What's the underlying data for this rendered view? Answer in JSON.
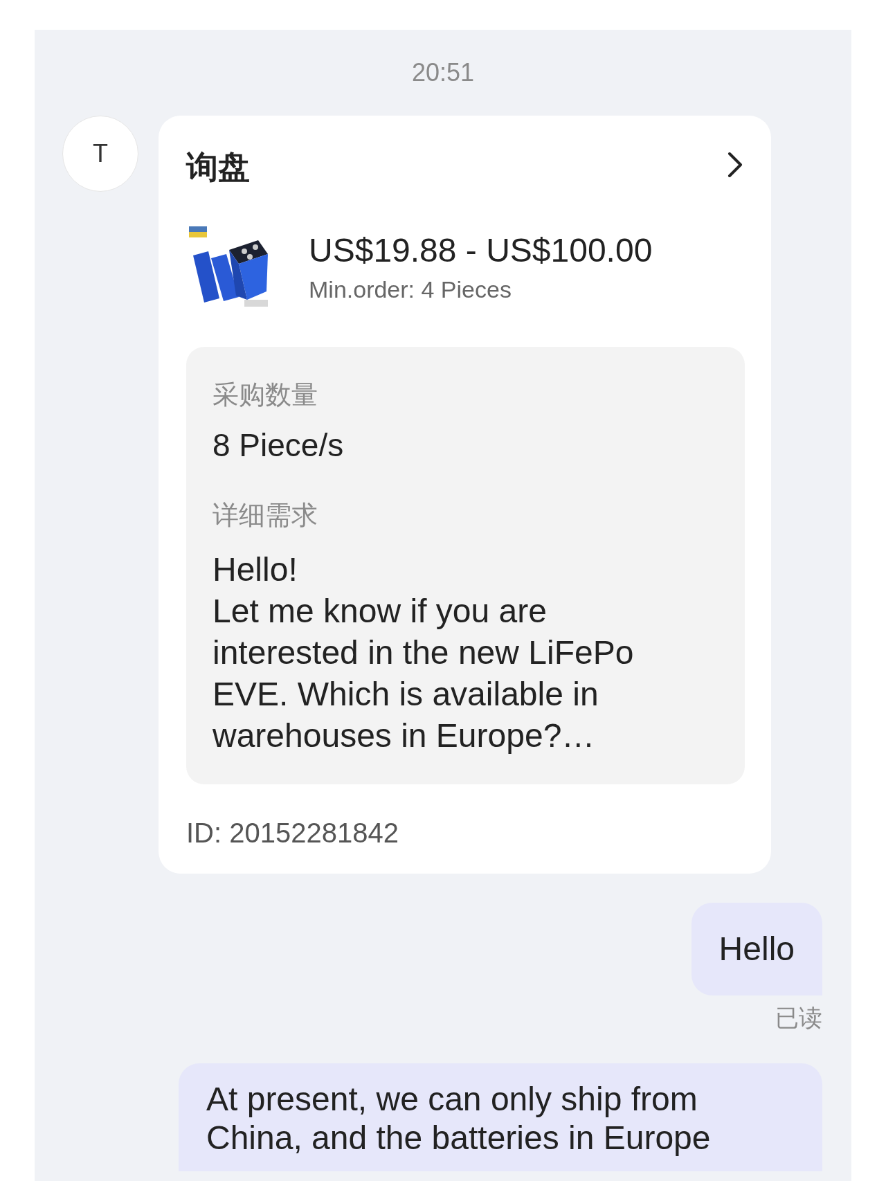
{
  "time": "20:51",
  "messages": [
    {
      "kind": "inquiry",
      "avatar": "T",
      "title": "询盘",
      "product": {
        "kind": "picture",
        "price": "US$19.88 - US$100.00",
        "min_order": "Min.order: 4 Pieces"
      },
      "fields": [
        {
          "label": "采购数量",
          "value": "8 Piece/s",
          "kind": "short"
        },
        {
          "label": "详细需求",
          "value": "Hello!\nLet me know if you are\ninterested in the new LiFePo\nEVE. Which is available in\nwarehouses in Europe?…",
          "kind": "long"
        }
      ],
      "id": "ID:  20152281842"
    },
    {
      "kind": "text",
      "text": "Hello",
      "status": "已读"
    },
    {
      "kind": "text",
      "text": "At present, we can only ship from\nChina, and the batteries in Europe",
      "wide": true
    }
  ]
}
